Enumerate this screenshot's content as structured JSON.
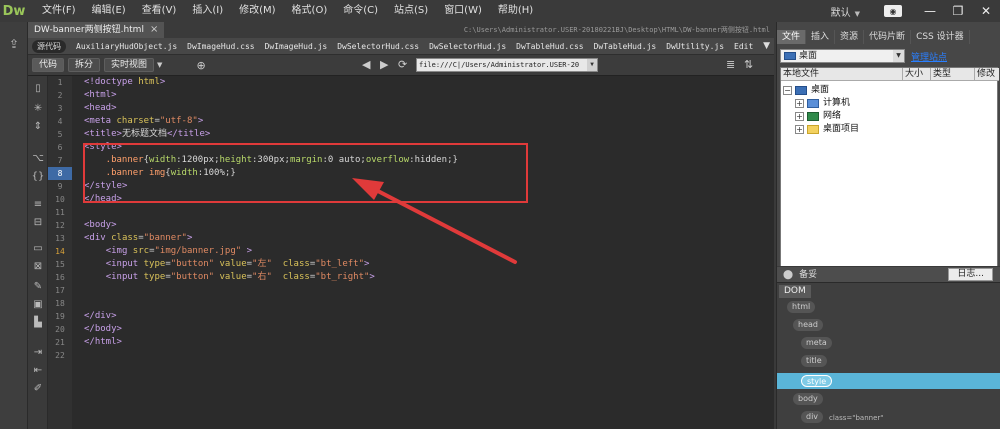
{
  "app": {
    "logo": "Dw",
    "menus": [
      "文件(F)",
      "编辑(E)",
      "查看(V)",
      "插入(I)",
      "修改(M)",
      "格式(O)",
      "命令(C)",
      "站点(S)",
      "窗口(W)",
      "帮助(H)"
    ],
    "workspace": "默认",
    "window_controls": [
      "—",
      "❐",
      "✕"
    ]
  },
  "document": {
    "tab_title": "DW-banner两侧按钮.html",
    "tab_close": "×",
    "path": "C:\\Users\\Administrator.USER-20180221BJ\\Desktop\\HTML\\DW-banner两侧按钮.html",
    "source_code": "源代码",
    "related_files": [
      "AuxiliaryHudObject.js",
      "DwImageHud.css",
      "DwImageHud.js",
      "DwSelectorHud.css",
      "DwSelectorHud.js",
      "DwTableHud.css",
      "DwTableHud.js",
      "DwUtility.js",
      "Edit"
    ]
  },
  "toolbar": {
    "code_label": "代码",
    "split_label": "拆分",
    "live_label": "实时视图",
    "address": "file:///C|/Users/Administrator.USER-20"
  },
  "editor": {
    "active_line": 8,
    "warning_line": 14,
    "lines": [
      "<!doctype html>",
      "<html>",
      "<head>",
      "<meta charset=\"utf-8\">",
      "<title>无标题文档</title>",
      "<style>",
      "    .banner{width:1200px;height:300px;margin:0 auto;overflow:hidden;}",
      "    .banner img{width:100%;}",
      "</style>",
      "</head>",
      "",
      "<body>",
      "<div class=\"banner\">",
      "    <img src=\"img/banner.jpg\" >",
      "    <input type=\"button\" value=\"左\"  class=\"bt_left\">",
      "    <input type=\"button\" value=\"右\"  class=\"bt_right\">",
      "",
      "",
      "</div>",
      "</body>",
      "</html>",
      ""
    ]
  },
  "right_panel": {
    "tabs": [
      "文件",
      "插入",
      "资源",
      "代码片断",
      "CSS 设计器"
    ],
    "site_select": "桌面",
    "manage_site": "管理站点",
    "columns": [
      "本地文件",
      "大小",
      "类型",
      "修改"
    ],
    "tree": [
      {
        "label": "桌面",
        "level": 0
      },
      {
        "label": "计算机",
        "level": 1
      },
      {
        "label": "网络",
        "level": 1
      },
      {
        "label": "桌面项目",
        "level": 1
      }
    ],
    "status": "备妥",
    "log_button": "日志...",
    "dom_tab": "DOM",
    "dom_nodes": [
      "html",
      "head",
      "meta",
      "title",
      "style",
      "body",
      "div"
    ],
    "dom_attr": "class=\"banner\""
  },
  "colors": {
    "annotation": "#e03a3a",
    "active_line": "#3e6aa5",
    "dom_selected": "#5ab5d8"
  }
}
